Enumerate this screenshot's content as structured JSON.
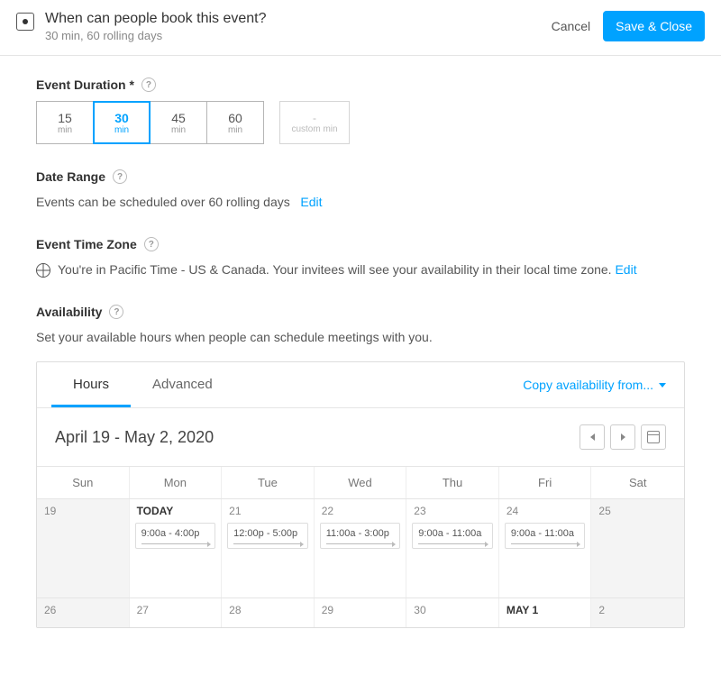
{
  "header": {
    "title": "When can people book this event?",
    "subtitle": "30 min, 60 rolling days",
    "cancel": "Cancel",
    "save": "Save & Close"
  },
  "duration": {
    "title": "Event Duration *",
    "options": [
      {
        "num": "15",
        "unit": "min"
      },
      {
        "num": "30",
        "unit": "min"
      },
      {
        "num": "45",
        "unit": "min"
      },
      {
        "num": "60",
        "unit": "min"
      }
    ],
    "custom": {
      "dash": "-",
      "unit": "custom min"
    },
    "selected_index": 1
  },
  "date_range": {
    "title": "Date Range",
    "text": "Events can be scheduled over 60 rolling days",
    "edit": "Edit"
  },
  "timezone": {
    "title": "Event Time Zone",
    "text": "You're in Pacific Time - US & Canada. Your invitees will see your availability in their local time zone.",
    "edit": "Edit"
  },
  "availability": {
    "title": "Availability",
    "subtitle": "Set your available hours when people can schedule meetings with you.",
    "tabs": [
      "Hours",
      "Advanced"
    ],
    "active_tab": 0,
    "copy_label": "Copy availability from...",
    "range_label": "April 19 - May 2, 2020",
    "weekdays": [
      "Sun",
      "Mon",
      "Tue",
      "Wed",
      "Thu",
      "Fri",
      "Sat"
    ],
    "week1": [
      {
        "num": "19",
        "disabled": true,
        "slots": []
      },
      {
        "num": "TODAY",
        "today": true,
        "slots": [
          "9:00a - 4:00p"
        ]
      },
      {
        "num": "21",
        "slots": [
          "12:00p - 5:00p"
        ]
      },
      {
        "num": "22",
        "slots": [
          "11:00a - 3:00p"
        ]
      },
      {
        "num": "23",
        "slots": [
          "9:00a - 11:00a"
        ]
      },
      {
        "num": "24",
        "slots": [
          "9:00a - 11:00a"
        ]
      },
      {
        "num": "25",
        "disabled": true,
        "slots": []
      }
    ],
    "week2": [
      {
        "num": "26",
        "disabled": true
      },
      {
        "num": "27"
      },
      {
        "num": "28"
      },
      {
        "num": "29"
      },
      {
        "num": "30"
      },
      {
        "num": "MAY 1",
        "bold": true
      },
      {
        "num": "2",
        "disabled": true
      }
    ]
  }
}
